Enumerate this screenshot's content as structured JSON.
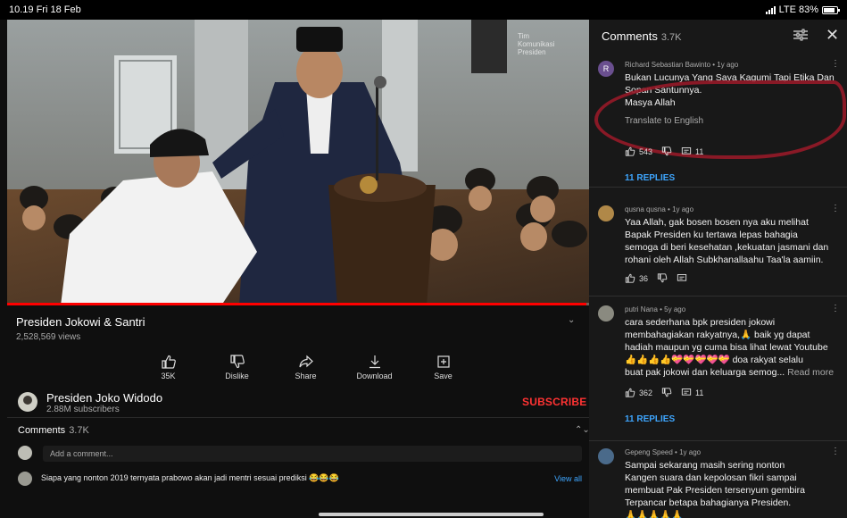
{
  "status_bar": {
    "time": "10.19  Fri 18 Feb",
    "network": "LTE 83%"
  },
  "video": {
    "watermark": "Tim Komunikasi Presiden",
    "progress": 0.995
  },
  "video_info": {
    "title": "Presiden Jokowi & Santri",
    "views": "2,528,569 views"
  },
  "actions": [
    {
      "label": "35K",
      "icon": "thumb-up-icon"
    },
    {
      "label": "Dislike",
      "icon": "thumb-down-icon"
    },
    {
      "label": "Share",
      "icon": "share-icon"
    },
    {
      "label": "Download",
      "icon": "download-icon"
    },
    {
      "label": "Save",
      "icon": "save-icon"
    }
  ],
  "channel": {
    "name": "Presiden Joko Widodo",
    "subscribers": "2.88M subscribers",
    "subscribe_label": "SUBSCRIBE"
  },
  "comments_section": {
    "title": "Comments",
    "count": "3.7K",
    "add_placeholder": "Add a comment...",
    "top_comment": "Siapa yang nonton 2019 ternyata prabowo akan jadi mentri sesuai prediksi 😂😂😂",
    "view_all": "View all"
  },
  "panel": {
    "title": "Comments",
    "count": "3.7K",
    "comments": [
      {
        "avatar_letter": "R",
        "avatar_color": "#6a4f8f",
        "author": "Richard Sebastian Bawinto • 1y ago",
        "text": [
          "Bukan Lucunya Yang Saya Kagumi Tapi Etika Dan",
          "Sopan Santunnya.",
          "Masya Allah"
        ],
        "link": "Translate to English",
        "likes": "543",
        "replies_count": "11",
        "replies_label": "11 REPLIES"
      },
      {
        "avatar_letter": "",
        "avatar_color": "#b08848",
        "author": "qusna qusna • 1y ago",
        "text": [
          "Yaa Allah, gak bosen  bosen nya aku melihat",
          "Bapak Presiden ku tertawa lepas bahagia",
          "semoga di beri kesehatan ,kekuatan jasmani dan",
          "rohani  oleh Allah Subkhanallaahu Taa'la aamiin."
        ],
        "likes": "36"
      },
      {
        "avatar_letter": "",
        "avatar_color": "#8a8a80",
        "author": "putri Nana • 5y ago",
        "text": [
          "cara sederhana bpk presiden jokowi",
          "membahagiakan rakyatnya,🙏 baik yg dapat",
          "hadiah maupun yg cuma bisa lihat lewat Youtube",
          "👍👍👍👍💝💝💝💝💝 doa rakyat selalu"
        ],
        "last_line": "buat pak jokowi dan keluarga semog...",
        "read_more": "Read more",
        "likes": "362",
        "replies_count": "11",
        "replies_label": "11 REPLIES"
      },
      {
        "avatar_letter": "",
        "avatar_color": "#4a6a8a",
        "author": "Gepeng Speed • 1y ago",
        "text": [
          "Sampai sekarang masih sering nonton",
          "Kangen suara dan kepolosan fikri sampai",
          "membuat Pak Presiden tersenyum gembira",
          "Terpancar betapa bahagianya Presiden.",
          "🙏🙏🙏🙏🙏"
        ]
      }
    ]
  }
}
